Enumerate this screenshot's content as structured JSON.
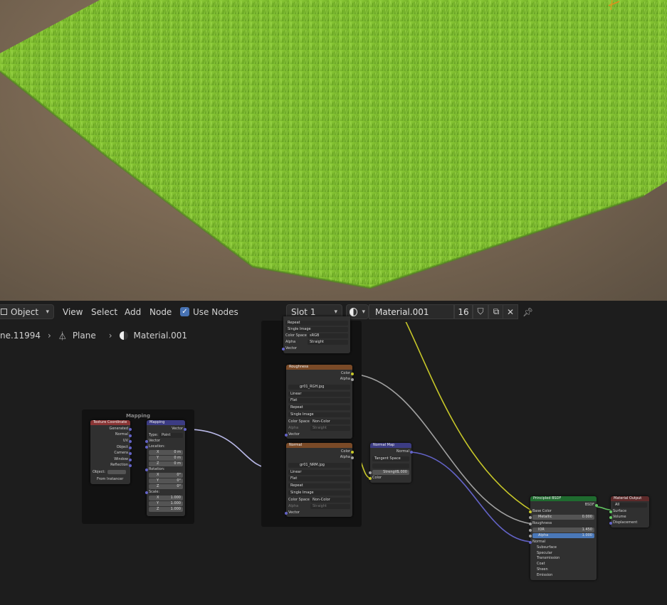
{
  "header": {
    "mode": "Object",
    "menus": [
      "View",
      "Select",
      "Add",
      "Node"
    ],
    "use_nodes_label": "Use Nodes",
    "slot": "Slot 1",
    "material_name": "Material.001",
    "users": "16"
  },
  "breadcrumb": {
    "object": "ne.11994",
    "mesh": "Plane",
    "material": "Material.001"
  },
  "frame_mapping": {
    "label": "Mapping"
  },
  "tex_coord": {
    "title": "Texture Coordinate",
    "outputs": [
      "Generated",
      "Normal",
      "UV",
      "Object",
      "Camera",
      "Window",
      "Reflection"
    ],
    "object_label": "Object:",
    "from_instancer": "From Instancer"
  },
  "mapping": {
    "title": "Mapping",
    "vector_out": "Vector",
    "type_label": "Type:",
    "type_value": "Point",
    "vector_in": "Vector",
    "location_label": "Location:",
    "location": [
      [
        "X",
        "0 m"
      ],
      [
        "Y",
        "0 m"
      ],
      [
        "Z",
        "0 m"
      ]
    ],
    "rotation_label": "Rotation:",
    "rotation": [
      [
        "X",
        "0°"
      ],
      [
        "Y",
        "0°"
      ],
      [
        "Z",
        "0°"
      ]
    ],
    "scale_label": "Scale:",
    "scale": [
      [
        "X",
        "1.000"
      ],
      [
        "Y",
        "1.000"
      ],
      [
        "Z",
        "1.000"
      ]
    ]
  },
  "top_image": {
    "rows": [
      "Repeat",
      "Single Image"
    ],
    "color_space_label": "Color Space",
    "color_space": "sRGB",
    "alpha_label": "Alpha",
    "alpha": "Straight",
    "vector": "Vector"
  },
  "roughness": {
    "title": "Roughness",
    "out_color": "Color",
    "out_alpha": "Alpha",
    "image": "gr01_RGH.jpg",
    "interp": "Linear",
    "projection": "Flat",
    "extension": "Repeat",
    "source": "Single Image",
    "color_space_label": "Color Space",
    "color_space": "Non-Color",
    "alpha_label": "Alpha",
    "alpha": "Straight",
    "vector": "Vector"
  },
  "normal_tex": {
    "title": "Normal",
    "out_color": "Color",
    "out_alpha": "Alpha",
    "image": "gr01_NRM.jpg",
    "interp": "Linear",
    "projection": "Flat",
    "extension": "Repeat",
    "source": "Single Image",
    "color_space_label": "Color Space",
    "color_space": "Non-Color",
    "alpha_label": "Alpha",
    "alpha": "Straight",
    "vector": "Vector"
  },
  "normal_map": {
    "title": "Normal Map",
    "out_normal": "Normal",
    "space": "Tangent Space",
    "uv": "",
    "strength_label": "Strength",
    "strength": "1.000",
    "color_in": "Color"
  },
  "bsdf": {
    "title": "Principled BSDF",
    "out": "BSDF",
    "base_color": "Base Color",
    "metallic_label": "Metallic",
    "metallic": "0.000",
    "roughness": "Roughness",
    "ior_label": "IOR",
    "ior": "1.450",
    "alpha_label": "Alpha",
    "alpha": "1.000",
    "normal": "Normal",
    "panels": [
      "Subsurface",
      "Specular",
      "Transmission",
      "Coat",
      "Sheen",
      "Emission"
    ]
  },
  "output": {
    "title": "Material Output",
    "target": "All",
    "inputs": [
      "Surface",
      "Volume",
      "Displacement"
    ]
  },
  "colors": {
    "wire_yellow": "#c7c729",
    "wire_grey": "#a1a1a1",
    "wire_purple": "#6363c7",
    "wire_green": "#63c763",
    "grass": "#7dbb2c"
  }
}
